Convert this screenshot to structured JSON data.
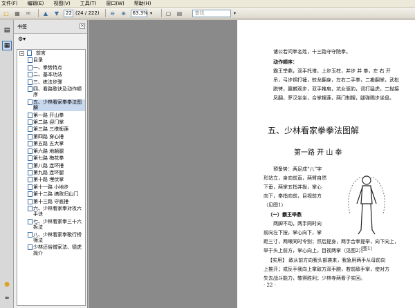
{
  "menubar": {
    "items": [
      "文件(F)",
      "编辑(E)",
      "视图(V)",
      "工具(T)",
      "窗口(W)",
      "帮助(H)"
    ]
  },
  "toolbar": {
    "page_input": "22",
    "page_total": "(24 / 222)",
    "zoom": "63.3%",
    "search_placeholder": "查找"
  },
  "panel": {
    "title": "书签",
    "bookmarks": [
      {
        "label": "前言",
        "level": 0
      },
      {
        "label": "目录",
        "level": 1
      },
      {
        "label": "一、拳势特点",
        "level": 1
      },
      {
        "label": "二、基本功法",
        "level": 1
      },
      {
        "label": "三、练法步骤",
        "level": 1
      },
      {
        "label": "四、看路歌诀及动作顺序",
        "level": 1
      },
      {
        "label": "五、少林看家拳拳法图解",
        "level": 1,
        "selected": true
      },
      {
        "label": "第一路  开山拳",
        "level": 1
      },
      {
        "label": "第二路  迎门掌",
        "level": 1
      },
      {
        "label": "第三路  三搭衡莲",
        "level": 1
      },
      {
        "label": "第四路  穿心捶",
        "level": 1
      },
      {
        "label": "第五路  五大掌",
        "level": 1
      },
      {
        "label": "第六路  地趟腿",
        "level": 1
      },
      {
        "label": "第七路  梅花拳",
        "level": 1
      },
      {
        "label": "第八路  连环捶",
        "level": 1
      },
      {
        "label": "第九路  连环腿",
        "level": 1
      },
      {
        "label": "第十路  埋伏掌",
        "level": 1
      },
      {
        "label": "第十一路  小地步",
        "level": 1
      },
      {
        "label": "第十二路  搞败归山门",
        "level": 1
      },
      {
        "label": "第十三路  守底捶",
        "level": 1
      },
      {
        "label": "六、少林看家拳对攻六手诀",
        "level": 1
      },
      {
        "label": "七、少林看家拳三十六拆法",
        "level": 1
      },
      {
        "label": "八、少林看家拳歌行桥筛法",
        "level": 1
      },
      {
        "label": "少林还俗僧家法、德虎简介",
        "level": 1
      }
    ]
  },
  "document": {
    "line1": "诸公若问拳名姓，十三路守守院拳。",
    "heading_order": "动作顺序：",
    "body_lines": [
      "霸王举鼎，双手托塔，上步玉柱，并步 并 拳，左 右 开",
      "吊，弓步铜打锤，蛟龙翻身，左右二手拳，二搬翻掌，武松",
      "脱铐，赢麟观步，双手推肩，坑女驱豹，词打猛虎，二抛接",
      "凤翻，罗汉坐坐，合掌摆莲，两门制摆，腿弹踢步坐盘。"
    ],
    "chapter_title": "五、少林看家拳拳法图解",
    "section_title": "第一路   开 山 拳",
    "prep_lines": [
      "预备势：两足成“八”字",
      "形站立，身向前直，两臂自然",
      "下垂，两掌五指并拢，掌心",
      "向下，拳指向前，目视前方",
      "（见图1）"
    ],
    "move1": "（一）霸王举鼎",
    "move1_lines": [
      "两脚不动，两手同时向",
      "前向左下按，掌心向下，掌",
      "距三寸，两眼同时令别；然后提身，两手合拳提举，向下向上，",
      "举于头上前方，掌心向上，目视两掌（见图2）。"
    ],
    "usage_lines": [
      "【实用】 敌从前方向我头部袭来，我急用两手从母前向",
      "上推开；或反手我向上拿敌方双手腕，若前敌手掌，使对方",
      "失去战斗能力，敬得胜利；少林寺两看子实回。"
    ],
    "figure_caption": "（图1）",
    "page_number": "· 22 ·"
  },
  "colors": {
    "accent": "#3a6ea5",
    "selection": "#c8d8ee",
    "background": "#d4d0c8"
  }
}
